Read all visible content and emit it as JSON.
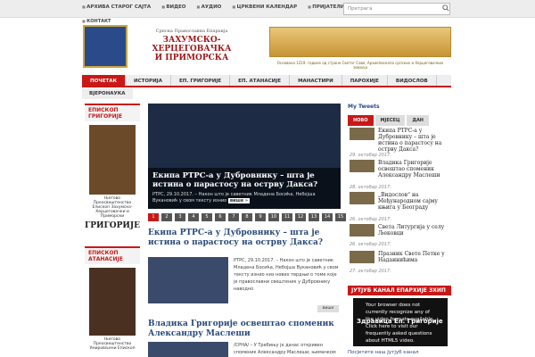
{
  "topnav": [
    "АРХИВА СТАРОГ САЈТА",
    "ВИДЕО",
    "АУДИО",
    "ЦРКВЕНИ КАЛЕНДАР",
    "ПРИЈАТЕЛИ САЈТА"
  ],
  "subnav": "КОНТАКТ",
  "search": {
    "placeholder": "Претрага"
  },
  "logo": {
    "line1": "Српска Православна Епархија",
    "line2": "ЗАХУМСКО-ХЕРЦЕГОВАЧКА",
    "line3": "И ПРИМОРСКА"
  },
  "banner_caption": "Основана 1219. године од стране Светог Саве, Архиепископа српских и Херцеговачких земаља",
  "mainnav": [
    "ПОЧЕТАК",
    "ИСТОРИЈА",
    "ЕП. ГРИГОРИЈЕ",
    "ЕП. АТАНАСИЈЕ",
    "МАНАСТИРИ",
    "ПАРОХИЈЕ",
    "ВИДОСЛОВ"
  ],
  "nav2": [
    "ВЈЕРОНАУКА"
  ],
  "bishop1": {
    "title": "ЕПИСКОП ГРИГОРИЈЕ",
    "caption": "Његово Преосвештенство Епископ Захумско-Херцеговачки и Приморски",
    "sign": "ГРИГОРИЈЕ"
  },
  "bishop2": {
    "title": "ЕПИСКОП АТАНАСИЈЕ",
    "caption": "Његово Преосвештенство Умировљени Епископ"
  },
  "slider": {
    "title": "Екипа РТРС-а у Дубровнику – шта је истина о парастосу на острву Дакса?",
    "text": "РТРС, 29.10.2017. – Након што је саветник Младена Босића, Небојша Вукановић у свом тексту изнио",
    "more": "више »",
    "pages": [
      "1",
      "2",
      "3",
      "4",
      "5",
      "6",
      "7",
      "8",
      "9",
      "10",
      "11",
      "12",
      "13",
      "14",
      "15"
    ]
  },
  "articles": [
    {
      "title": "Екипа РТРС-а у Дубровнику – шта је истина о парастосу на острву Дакса?",
      "text": "РТРС, 29.10.2017. – Након што је саветник Младена Босића, Небојша Вукановић у свом тексту изнио низ нових тврдњи о томе које је православни свештеник у Дубровнику наводно",
      "more": "више"
    },
    {
      "title": "Владика Григорије освештао споменик Александру Маслеши",
      "text": "/СРНА/ – У Требињу је данас откривен споменик Александру Маслеши, њемачком"
    }
  ],
  "right": {
    "title": "My Tweets",
    "tabs": [
      "НОВО",
      "МЈЕСЕЦ",
      "ДАН"
    ],
    "items": [
      {
        "title": "Екипа РТРС-а у Дубровнику – шта је истина о парастосу на острву Дакса?",
        "date": "29. октобар 2017."
      },
      {
        "title": "Владика Григорије освештао споменик Александру Маслеши",
        "date": "28. октобар 2017."
      },
      {
        "title": "„Видослов“ на Међународном сајму књига у Београду",
        "date": "26. октобар 2017."
      },
      {
        "title": "Света Литургија у селу Љековци",
        "date": "26. октобар 2017."
      },
      {
        "title": "Празник Свете Петке у Надаинићима",
        "date": "27. октобар 2017."
      }
    ],
    "yt_title": "ЈУТЈУБ КАНАЛ ЕПАРХИЈЕ ЗХИП",
    "yt_text": "Your browser does not currently recognize any of the video formats available. Click here to visit our frequently asked questions about HTML5 video.",
    "yt_overlay": "Здравица Еп. Григорије",
    "yt_footer": "Посјетите наш Јутјуб канал"
  },
  "colors": {
    "accent": "#c81818",
    "link": "#2a4a7a"
  }
}
